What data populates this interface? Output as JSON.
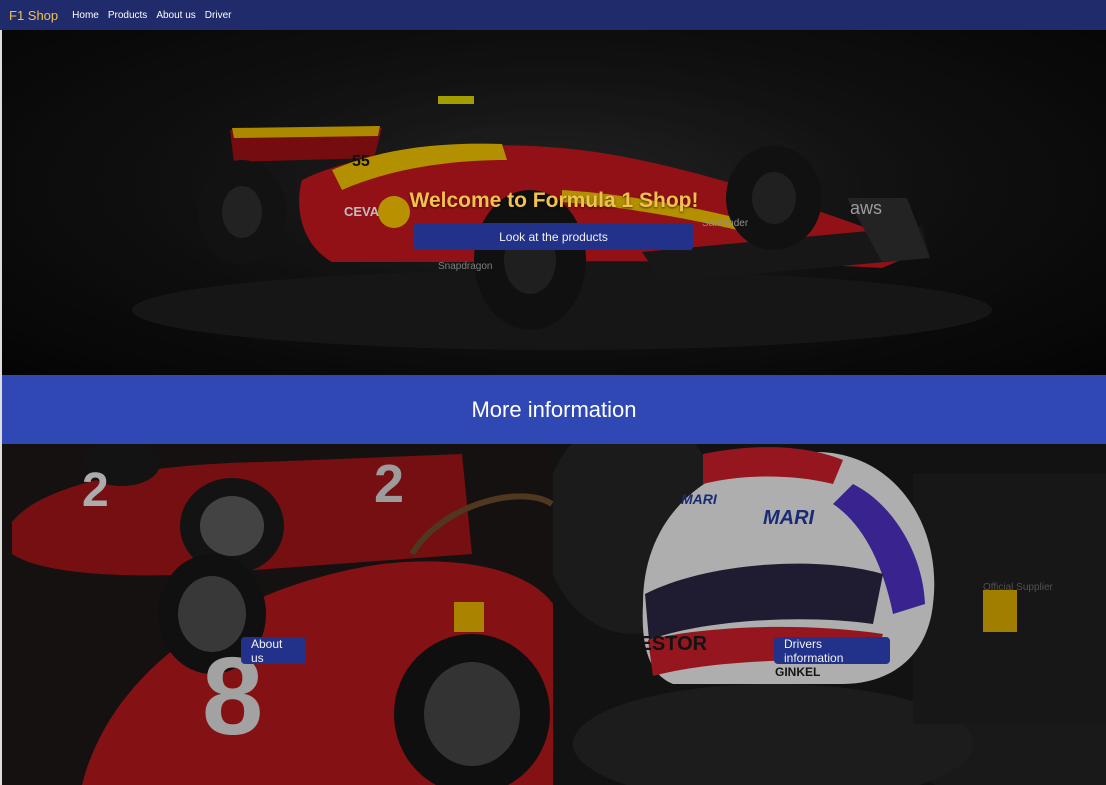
{
  "navbar": {
    "brand": "F1 Shop",
    "links": [
      "Home",
      "Products",
      "About us",
      "Driver"
    ]
  },
  "hero": {
    "title": "Welcome to Formula 1 Shop!",
    "button_label": "Look at the products",
    "image_text": {
      "number": "55",
      "sponsor_left": "CEVA",
      "sponsor_right": "aws",
      "sponsor_bottom": "Snapdragon",
      "sponsor_wing": "Santander"
    }
  },
  "info": {
    "title": "More information"
  },
  "cards": {
    "about": {
      "button_label": "About us",
      "image_text": {
        "number_top": "2",
        "number_front": "8"
      }
    },
    "drivers": {
      "button_label": "Drivers information",
      "image_text": {
        "helmet_sponsor": "MARI",
        "helmet_side": "GESTOR",
        "helmet_bottom": "GINKEL",
        "badge": "Official Supplier"
      }
    }
  },
  "colors": {
    "nav_bg": "#1f2b6b",
    "brand": "#f2c14e",
    "button_bg": "#22318a",
    "banner_bg": "#2f48b3",
    "car_red": "#b3151d",
    "car_yellow": "#e0b800"
  }
}
